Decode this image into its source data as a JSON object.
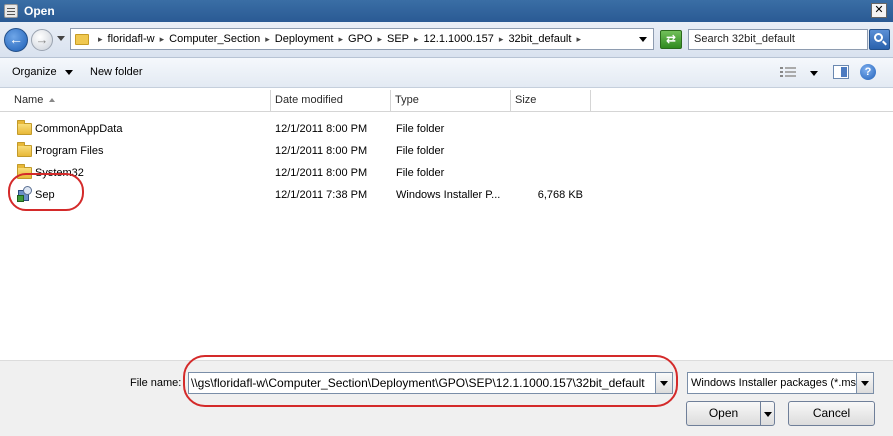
{
  "window": {
    "title": "Open"
  },
  "address": {
    "crumbs": [
      "floridafl-w",
      "Computer_Section",
      "Deployment",
      "GPO",
      "SEP",
      "12.1.1000.157",
      "32bit_default"
    ],
    "search_placeholder": "Search 32bit_default"
  },
  "toolbar": {
    "organize_label": "Organize",
    "new_folder_label": "New folder"
  },
  "columns": {
    "name": "Name",
    "date": "Date modified",
    "type": "Type",
    "size": "Size"
  },
  "files": [
    {
      "name": "CommonAppData",
      "date": "12/1/2011 8:00 PM",
      "type": "File folder",
      "size": "",
      "icon": "folder-icon"
    },
    {
      "name": "Program Files",
      "date": "12/1/2011 8:00 PM",
      "type": "File folder",
      "size": "",
      "icon": "folder-icon"
    },
    {
      "name": "System32",
      "date": "12/1/2011 8:00 PM",
      "type": "File folder",
      "size": "",
      "icon": "folder-icon"
    },
    {
      "name": "Sep",
      "date": "12/1/2011 7:38 PM",
      "type": "Windows Installer P...",
      "size": "6,768 KB",
      "icon": "installer-package-icon"
    }
  ],
  "bottom": {
    "file_name_label": "File name:",
    "file_name_value": "\\\\gs\\floridafl-w\\Computer_Section\\Deployment\\GPO\\SEP\\12.1.1000.157\\32bit_default",
    "file_type_value": "Windows Installer packages (*.msi)",
    "open_label": "Open",
    "cancel_label": "Cancel"
  },
  "colors": {
    "annotation_red": "#d42a2a",
    "title_blue": "#2a5a94"
  }
}
